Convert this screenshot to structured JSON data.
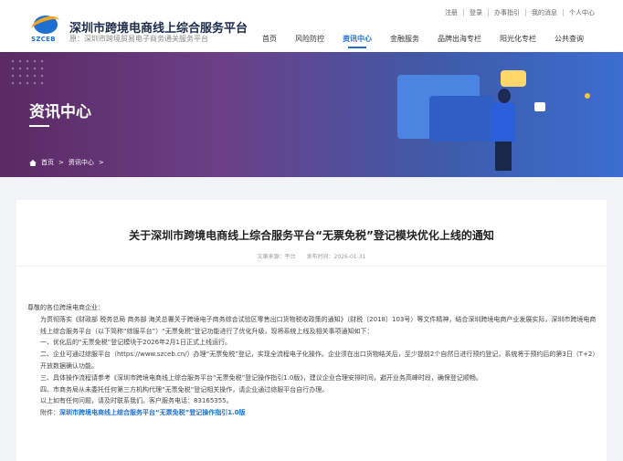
{
  "header": {
    "logo_text": "SZCEB",
    "title": "深圳市跨境电商线上综合服务平台",
    "subtitle": "原：深圳市跨境贸易电子商务通关服务平台",
    "top_links": [
      "注册",
      "登录",
      "办事指引",
      "我的消息",
      "个人中心"
    ],
    "nav": [
      {
        "label": "首页",
        "active": false
      },
      {
        "label": "风险防控",
        "active": false
      },
      {
        "label": "资讯中心",
        "active": true
      },
      {
        "label": "金融服务",
        "active": false
      },
      {
        "label": "品牌出海专栏",
        "active": false
      },
      {
        "label": "阳光化专栏",
        "active": false
      },
      {
        "label": "公共查询",
        "active": false
      }
    ]
  },
  "banner": {
    "title": "资讯中心",
    "breadcrumb": [
      "首页",
      ">",
      "资讯中心",
      ">"
    ]
  },
  "article": {
    "title": "关于深圳市跨境电商线上综合服务平台“无票免税”登记模块优化上线的通知",
    "source": "文章来源：平台",
    "time": "发布时间：2026-01-31",
    "paragraphs": [
      "尊敬的各位跨境电商企业：",
      "为贯彻落实《财政部 税务总局 商务部 海关总署关于跨境电子商务综合试验区零售出口货物税收政策的通知》（财税〔2018〕103号）等文件精神，结合深圳跨境电商产业发展实际，深圳市跨境电商线上综合服务平台（以下简称“综服平台”）“无票免税”登记功能进行了优化升级，现将系统上线及相关事项通知如下：",
      "一、优化后的“无票免税”登记模块于2026年2月1日正式上线运行。",
      "二、企业可通过综服平台（https://www.szceb.cn/）办理“无票免税”登记，实现全流程电子化操作。企业须在出口货物结关后，至少提前2个自然日进行预约登记，系统将于预约后的第3日（T+2）开放数据确认功能。",
      "三、具体操作流程请参考《深圳市跨境电商线上综合服务平台“无票免税”登记操作指引1.0版》，建议企业合理安排时间，避开业务高峰时段，确保登记顺畅。",
      "四、市商务局从未委托任何第三方机构代理“无票免税”登记相关操作，请企业通过综服平台自行办理。",
      "以上如有任何问题，请及时联系我们。客户服务电话：83165355。"
    ],
    "attachment_label": "附件：",
    "attachment_link": "深圳市跨境电商线上综合服务平台“无票免税”登记操作指引1.0版"
  },
  "colors": {
    "accent": "#1f6fd1",
    "banner_start": "#5a2a63",
    "banner_end": "#3b6ed0"
  }
}
